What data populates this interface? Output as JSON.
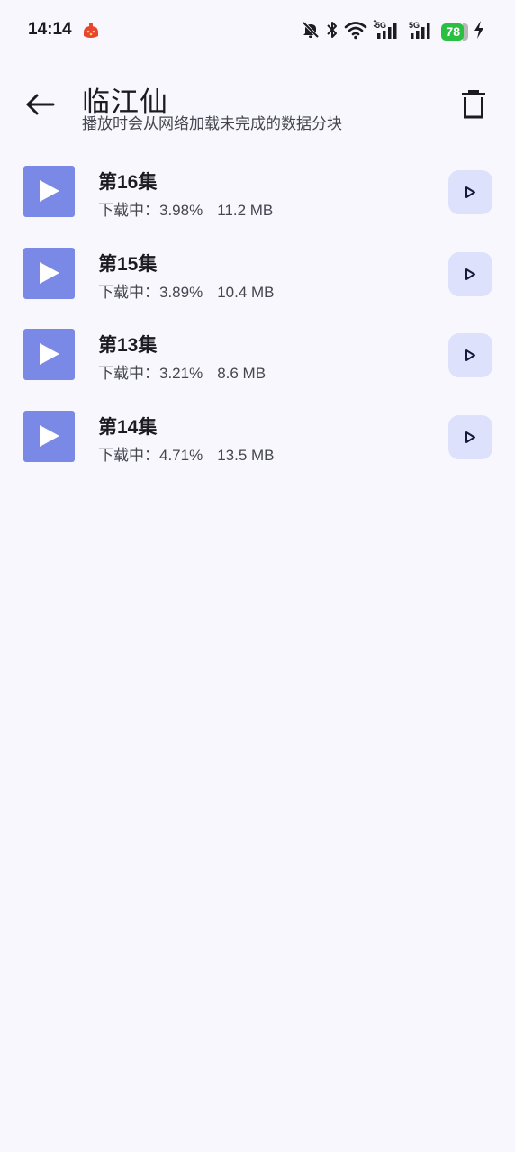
{
  "status_bar": {
    "time": "14:14",
    "battery": "78",
    "network_1": "5G",
    "network_2": "5G",
    "icons": [
      "notification-badge-icon",
      "mute-icon",
      "bluetooth-icon",
      "wifi-icon",
      "signal-5g-icon",
      "signal-5g-icon",
      "battery-icon",
      "charging-icon"
    ]
  },
  "header": {
    "title": "临江仙",
    "subtitle": "播放时会从网络加载未完成的数据分块",
    "back_icon": "arrow-left-icon",
    "delete_icon": "trash-icon"
  },
  "episodes": [
    {
      "title": "第16集",
      "status_label": "下载中：",
      "progress": "3.98%",
      "size": "11.2 MB"
    },
    {
      "title": "第15集",
      "status_label": "下载中：",
      "progress": "3.89%",
      "size": "10.4 MB"
    },
    {
      "title": "第13集",
      "status_label": "下载中：",
      "progress": "3.21%",
      "size": "8.6 MB"
    },
    {
      "title": "第14集",
      "status_label": "下载中：",
      "progress": "4.71%",
      "size": "13.5 MB"
    }
  ],
  "colors": {
    "background": "#f8f7fd",
    "thumbnail": "#7b89e6",
    "play_button_bg": "#dde1fb",
    "battery": "#29c041"
  }
}
